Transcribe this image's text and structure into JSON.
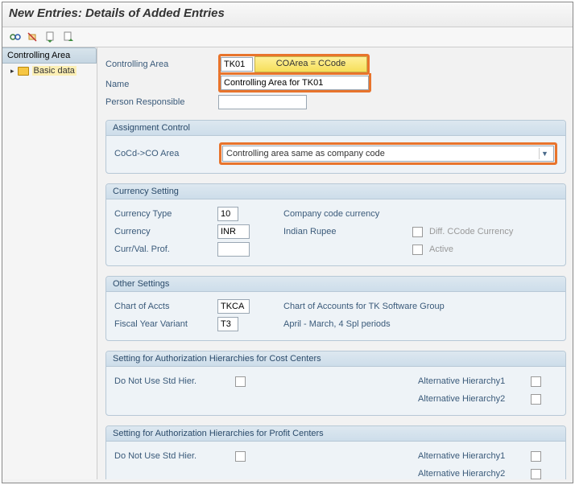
{
  "title": "New Entries: Details of Added Entries",
  "sidebar": {
    "header": "Controlling Area",
    "items": [
      {
        "label": "Basic data"
      }
    ]
  },
  "top_fields": {
    "controlling_area_label": "Controlling Area",
    "controlling_area_value": "TK01",
    "coarea_button": "COArea = CCode",
    "name_label": "Name",
    "name_value": "Controlling Area for TK01",
    "person_resp_label": "Person Responsible",
    "person_resp_value": ""
  },
  "assignment": {
    "group_title": "Assignment Control",
    "field_label": "CoCd->CO Area",
    "dropdown_value": "Controlling area same as company code"
  },
  "currency": {
    "group_title": "Currency Setting",
    "type_label": "Currency Type",
    "type_value": "10",
    "type_desc": "Company code currency",
    "currency_label": "Currency",
    "currency_value": "INR",
    "currency_desc": "Indian Rupee",
    "diff_label": "Diff. CCode Currency",
    "prof_label": "Curr/Val. Prof.",
    "prof_value": "",
    "active_label": "Active"
  },
  "other": {
    "group_title": "Other Settings",
    "coa_label": "Chart of Accts",
    "coa_value": "TKCA",
    "coa_desc": "Chart of Accounts for TK Software Group",
    "fyv_label": "Fiscal Year Variant",
    "fyv_value": "T3",
    "fyv_desc": "April - March, 4 Spl periods"
  },
  "auth_cc": {
    "group_title": "Setting for Authorization Hierarchies for Cost Centers",
    "no_std_label": "Do Not Use Std Hier.",
    "alt1_label": "Alternative Hierarchy1",
    "alt2_label": "Alternative Hierarchy2"
  },
  "auth_pc": {
    "group_title": "Setting for Authorization Hierarchies for Profit Centers",
    "no_std_label": "Do Not Use Std Hier.",
    "alt1_label": "Alternative Hierarchy1",
    "alt2_label": "Alternative Hierarchy2"
  }
}
